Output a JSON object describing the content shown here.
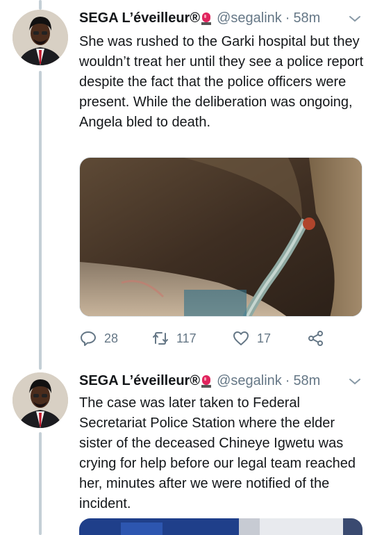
{
  "tweets": [
    {
      "author_name": "SEGA L’éveilleur",
      "registered_mark": "®",
      "badge_icon": "red-light-emoji",
      "handle": "@segalink",
      "separator": "·",
      "time": "58m",
      "text": "She was rushed to the Garki hospital but they wouldn’t treat her until they see a police report despite the fact that the police officers were present. While the deliberation was ongoing, Angela bled to death.",
      "actions": {
        "replies": "28",
        "retweets": "117",
        "likes": "17"
      }
    },
    {
      "author_name": "SEGA L’éveilleur",
      "registered_mark": "®",
      "badge_icon": "red-light-emoji",
      "handle": "@segalink",
      "separator": "·",
      "time": "58m",
      "text": "The case was later taken to Federal Secretariat Police Station where the elder sister of the deceased Chineye Igwetu was crying for help before our legal team reached her, minutes after we were notified of the incident."
    }
  ],
  "colors": {
    "text": "#14171a",
    "muted": "#657786",
    "thread_line": "#c4cfd6",
    "badge_red": "#e0245e"
  }
}
